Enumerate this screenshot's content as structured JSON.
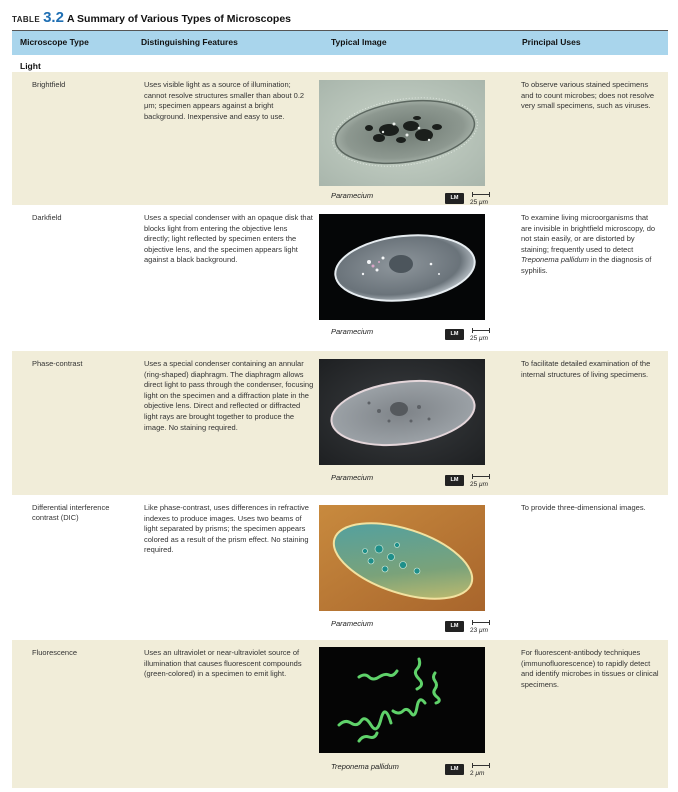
{
  "table": {
    "label": "TABLE",
    "number": "3.2",
    "title": "A Summary of Various Types of Microscopes"
  },
  "headers": {
    "type": "Microscope Type",
    "features": "Distinguishing Features",
    "image": "Typical Image",
    "uses": "Principal Uses"
  },
  "section_label": "Light",
  "lm_badge": "LM",
  "rows": [
    {
      "type": "Brightfield",
      "features": "Uses visible light as a source of illumination; cannot resolve structures smaller than about 0.2 μm; specimen appears against a bright background. Inexpensive and easy to use.",
      "caption": "Paramecium",
      "scale_value": "25",
      "scale_unit": "μm",
      "uses": "To observe various stained specimens and to count microbes; does not resolve very small specimens, such as viruses."
    },
    {
      "type": "Darkfield",
      "features": "Uses a special condenser with an opaque disk that blocks light from entering the objective lens directly; light reflected by specimen enters the objective lens, and the specimen appears light against a black background.",
      "caption": "Paramecium",
      "scale_value": "25",
      "scale_unit": "μm",
      "uses_before": "To examine living microorganisms that are invisible in brightfield microscopy, do not stain easily, or are distorted by staining; frequently used to detect ",
      "uses_italic": "Treponema pallidum",
      "uses_after": " in the diagnosis of syphilis."
    },
    {
      "type": "Phase-contrast",
      "features": "Uses a special condenser containing an annular (ring-shaped) diaphragm. The diaphragm allows direct light to pass through the condenser, focusing light on the specimen and a diffraction plate in the objective lens. Direct and reflected or diffracted light rays are brought together to produce the image. No staining required.",
      "caption": "Paramecium",
      "scale_value": "25",
      "scale_unit": "μm",
      "uses": "To facilitate detailed examination of the internal structures of living specimens."
    },
    {
      "type": "Differential interference contrast (DIC)",
      "features": "Like phase-contrast, uses differences in refractive indexes to produce images. Uses two beams of light separated by prisms; the specimen appears colored as a result of the prism effect. No staining required.",
      "caption": "Paramecium",
      "scale_value": "23",
      "scale_unit": "μm",
      "uses": "To provide three-dimensional images."
    },
    {
      "type": "Fluorescence",
      "features": "Uses an ultraviolet or near-ultraviolet source of illumination that causes fluorescent compounds (green-colored) in a specimen to emit light.",
      "caption": "Treponema pallidum",
      "scale_value": "2",
      "scale_unit": "μm",
      "uses": "For fluorescent-antibody techniques (immunofluorescence) to rapidly detect and identify microbes in tissues or clinical specimens."
    }
  ],
  "colors": {
    "accent": "#1f6fb3",
    "header_bg": "#a9d5ec",
    "row_shade": "#f1edd9"
  }
}
